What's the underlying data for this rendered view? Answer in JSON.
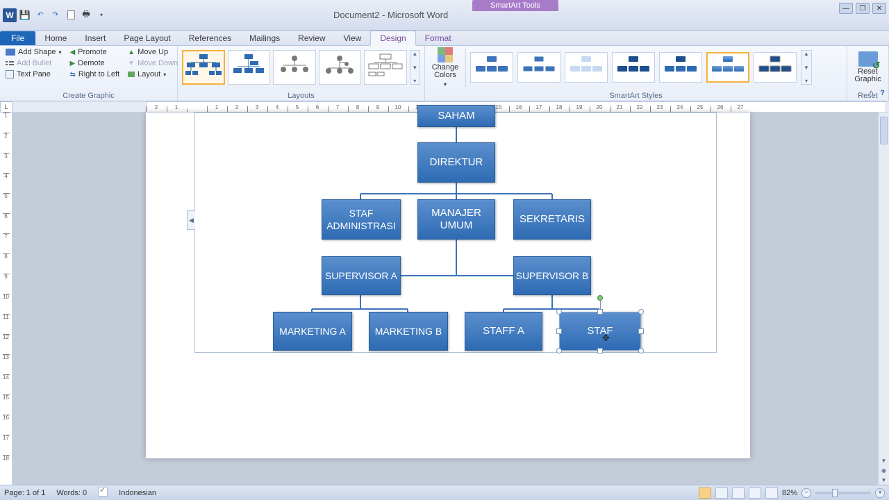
{
  "title": "Document2 - Microsoft Word",
  "contextual_tab": "SmartArt Tools",
  "tabs": {
    "file": "File",
    "home": "Home",
    "insert": "Insert",
    "page_layout": "Page Layout",
    "references": "References",
    "mailings": "Mailings",
    "review": "Review",
    "view": "View",
    "design": "Design",
    "format": "Format"
  },
  "ribbon": {
    "create_graphic": {
      "label": "Create Graphic",
      "add_shape": "Add Shape",
      "add_bullet": "Add Bullet",
      "text_pane": "Text Pane",
      "promote": "Promote",
      "demote": "Demote",
      "right_to_left": "Right to Left",
      "move_up": "Move Up",
      "move_down": "Move Down",
      "layout": "Layout"
    },
    "layouts": {
      "label": "Layouts"
    },
    "styles": {
      "label": "SmartArt Styles",
      "change_colors": "Change Colors"
    },
    "reset": {
      "label": "Reset",
      "button": "Reset Graphic"
    }
  },
  "smartart": {
    "nodes": {
      "top_clipped": "SAHAM",
      "direktur": "DIREKTUR",
      "staf_admin": "STAF ADMINISTRASI",
      "manajer": "MANAJER UMUM",
      "sekretaris": "SEKRETARIS",
      "supervisor_a": "SUPERVISOR A",
      "supervisor_b": "SUPERVISOR B",
      "marketing_a": "MARKETING A",
      "marketing_b": "MARKETING B",
      "staff_a": "STAFF A",
      "staff_b_editing": "STAF"
    }
  },
  "status": {
    "page": "Page: 1 of 1",
    "words": "Words: 0",
    "language": "Indonesian",
    "zoom": "82%"
  }
}
